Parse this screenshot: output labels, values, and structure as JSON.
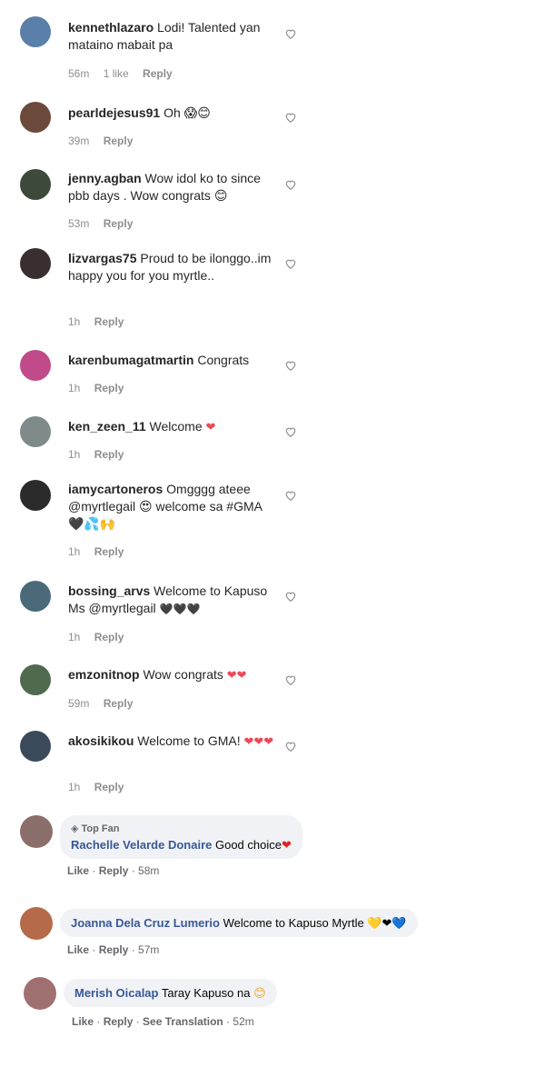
{
  "ig_comments": [
    {
      "user": "kennethlazaro",
      "text": "Lodi! Talented yan mataino mabait pa",
      "time": "56m",
      "likes": "1 like",
      "reply": "Reply",
      "avatar_color": "#5a7fa8"
    },
    {
      "user": "pearldejesus91",
      "text": "Oh 😱😊",
      "time": "39m",
      "reply": "Reply",
      "avatar_color": "#6b4a3c"
    },
    {
      "user": "jenny.agban",
      "text": "Wow idol ko to since pbb days . Wow congrats 😊",
      "time": "53m",
      "reply": "Reply",
      "avatar_color": "#3d4a3a"
    },
    {
      "user": "lizvargas75",
      "text": "Proud to be ilonggo..im happy you for you myrtle..",
      "time": "1h",
      "reply": "Reply",
      "avatar_color": "#3a2f30"
    },
    {
      "user": "karenbumagatmartin",
      "text": "Congrats",
      "time": "1h",
      "reply": "Reply",
      "avatar_color": "#c04a8a"
    },
    {
      "user": "ken_zeen_11",
      "text": "Welcome",
      "emoji": "❤",
      "time": "1h",
      "reply": "Reply",
      "avatar_color": "#7f8a8a"
    },
    {
      "user": "iamycartoneros",
      "text": "Omgggg ateee @myrtlegail 😍 welcome sa #GMA 🖤💦🙌",
      "time": "1h",
      "reply": "Reply",
      "avatar_color": "#2b2b2b"
    },
    {
      "user": "bossing_arvs",
      "text": "Welcome to Kapuso Ms @myrtlegail",
      "emoji": "🖤🖤🖤",
      "time": "1h",
      "reply": "Reply",
      "avatar_color": "#4a6a7a"
    },
    {
      "user": "emzonitnop",
      "text": "Wow congrats",
      "emoji": "❤❤",
      "time": "59m",
      "reply": "Reply",
      "avatar_color": "#4f6a4f"
    },
    {
      "user": "akosikikou",
      "text": "Welcome to GMA!",
      "emoji": "❤❤❤",
      "time": "1h",
      "reply": "Reply",
      "avatar_color": "#3a4a5a"
    }
  ],
  "fb_comments": [
    {
      "badge": "Top Fan",
      "name": "Rachelle Velarde Donaire",
      "text": "Good choice",
      "emoji": "❤",
      "like": "Like",
      "reply": "Reply",
      "time": "58m",
      "avatar_color": "#8a6f6a"
    },
    {
      "name": "Joanna Dela Cruz Lumerio",
      "text": "Welcome to Kapuso Myrtle",
      "emoji": "💛❤💙",
      "like": "Like",
      "reply": "Reply",
      "time": "57m",
      "avatar_color": "#b56a4a"
    },
    {
      "name": "Merish Oicalap",
      "text": "Taray Kapuso na",
      "emoji": "😊",
      "like": "Like",
      "reply": "Reply",
      "see_translation": "See Translation",
      "time": "52m",
      "avatar_color": "#a07070"
    }
  ],
  "icons": {
    "like": "heart-outline-icon",
    "topfan": "top-fan-badge-icon"
  }
}
